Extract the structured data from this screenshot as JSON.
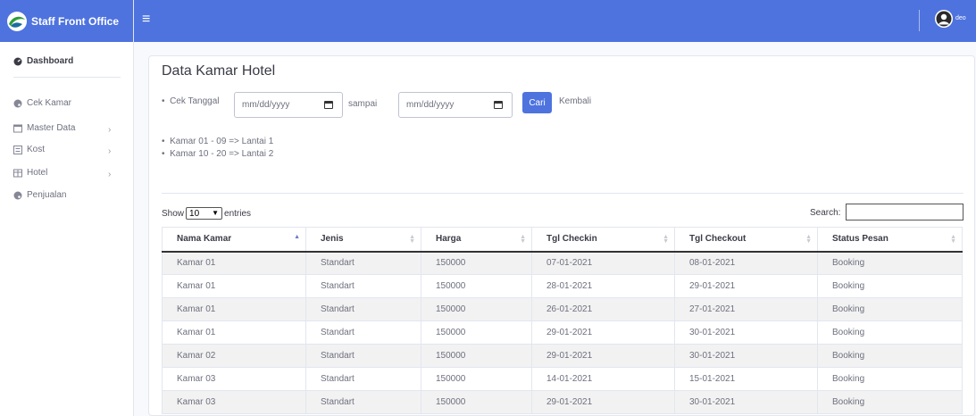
{
  "app": {
    "brand": "Staff Front Office"
  },
  "topbar": {
    "menu_icon": "bars-icon",
    "user_name": "deo"
  },
  "sidebar": {
    "items": [
      {
        "label": "Dashboard",
        "icon": "tachometer-icon"
      },
      {
        "label": "Cek Kamar",
        "icon": "palette-icon"
      },
      {
        "label": "Master Data",
        "icon": "window-icon"
      },
      {
        "label": "Kost",
        "icon": "list-box-icon"
      },
      {
        "label": "Hotel",
        "icon": "table-icon"
      },
      {
        "label": "Penjualan",
        "icon": "palette-icon"
      }
    ]
  },
  "main": {
    "title": "Data Kamar Hotel",
    "filter": {
      "label": "Cek Tanggal",
      "from_placeholder": "mm/dd/yyyy",
      "between": "sampai",
      "to_placeholder": "mm/dd/yyyy",
      "submit": "Cari",
      "back": "Kembali"
    },
    "notes": [
      "Kamar 01 - 09 => Lantai 1",
      "Kamar 10 - 20 => Lantai 2"
    ],
    "table_controls": {
      "show": "Show",
      "length_value": "10",
      "entries": "entries",
      "search_label": "Search:"
    },
    "table": {
      "columns": [
        "Nama Kamar",
        "Jenis",
        "Harga",
        "Tgl Checkin",
        "Tgl Checkout",
        "Status Pesan"
      ],
      "rows": [
        [
          "Kamar 01",
          "Standart",
          "150000",
          "07-01-2021",
          "08-01-2021",
          "Booking"
        ],
        [
          "Kamar 01",
          "Standart",
          "150000",
          "28-01-2021",
          "29-01-2021",
          "Booking"
        ],
        [
          "Kamar 01",
          "Standart",
          "150000",
          "26-01-2021",
          "27-01-2021",
          "Booking"
        ],
        [
          "Kamar 01",
          "Standart",
          "150000",
          "29-01-2021",
          "30-01-2021",
          "Booking"
        ],
        [
          "Kamar 02",
          "Standart",
          "150000",
          "29-01-2021",
          "30-01-2021",
          "Booking"
        ],
        [
          "Kamar 03",
          "Standart",
          "150000",
          "14-01-2021",
          "15-01-2021",
          "Booking"
        ],
        [
          "Kamar 03",
          "Standart",
          "150000",
          "29-01-2021",
          "30-01-2021",
          "Booking"
        ]
      ]
    }
  },
  "colors": {
    "primary": "#4e73df",
    "text": "#5a5c69"
  }
}
